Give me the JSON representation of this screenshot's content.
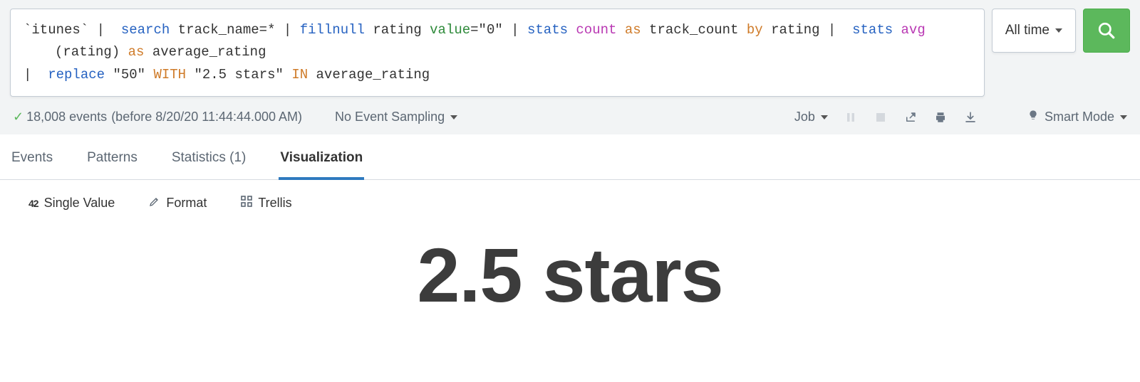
{
  "query": {
    "tokens_line1": [
      {
        "t": "`itunes`",
        "c": "tok-macro"
      },
      {
        "t": " | ",
        "c": "tok-pipe"
      },
      {
        "t": " ",
        "c": ""
      },
      {
        "t": "search",
        "c": "tok-cmd"
      },
      {
        "t": " track_name=* | ",
        "c": "tok-pipe"
      },
      {
        "t": "fillnull",
        "c": "tok-cmd"
      },
      {
        "t": " rating ",
        "c": "tok-pipe"
      },
      {
        "t": "value",
        "c": "tok-arg"
      },
      {
        "t": "=\"0\" | ",
        "c": "tok-pipe"
      },
      {
        "t": "stats",
        "c": "tok-cmd"
      },
      {
        "t": " ",
        "c": ""
      },
      {
        "t": "count",
        "c": "tok-func"
      },
      {
        "t": " ",
        "c": ""
      },
      {
        "t": "as",
        "c": "tok-kw"
      },
      {
        "t": " track_count ",
        "c": "tok-pipe"
      },
      {
        "t": "by",
        "c": "tok-kw"
      },
      {
        "t": " rating |  ",
        "c": "tok-pipe"
      },
      {
        "t": "stats",
        "c": "tok-cmd"
      },
      {
        "t": " ",
        "c": ""
      },
      {
        "t": "avg",
        "c": "tok-func"
      }
    ],
    "tokens_line2": [
      {
        "t": "(rating) ",
        "c": "tok-pipe"
      },
      {
        "t": "as",
        "c": "tok-kw"
      },
      {
        "t": " average_rating",
        "c": "tok-pipe"
      }
    ],
    "tokens_line3": [
      {
        "t": "| ",
        "c": "tok-pipe"
      },
      {
        "t": " ",
        "c": ""
      },
      {
        "t": "replace",
        "c": "tok-cmd"
      },
      {
        "t": " \"50\" ",
        "c": "tok-str"
      },
      {
        "t": "WITH",
        "c": "tok-kw"
      },
      {
        "t": " \"2.5 stars\" ",
        "c": "tok-str"
      },
      {
        "t": "IN",
        "c": "tok-kw"
      },
      {
        "t": " average_rating",
        "c": "tok-pipe"
      }
    ]
  },
  "time_picker": {
    "label": "All time"
  },
  "status": {
    "event_count": "18,008 events",
    "before_text": "(before 8/20/20 11:44:44.000 AM)",
    "sampling": "No Event Sampling",
    "job_label": "Job",
    "smart_mode": "Smart Mode"
  },
  "tabs": {
    "events": "Events",
    "patterns": "Patterns",
    "statistics": "Statistics (1)",
    "visualization": "Visualization"
  },
  "viz_toolbar": {
    "type_label": "Single Value",
    "type_icon": "42",
    "format_label": "Format",
    "trellis_label": "Trellis"
  },
  "result": {
    "single_value": "2.5 stars"
  }
}
